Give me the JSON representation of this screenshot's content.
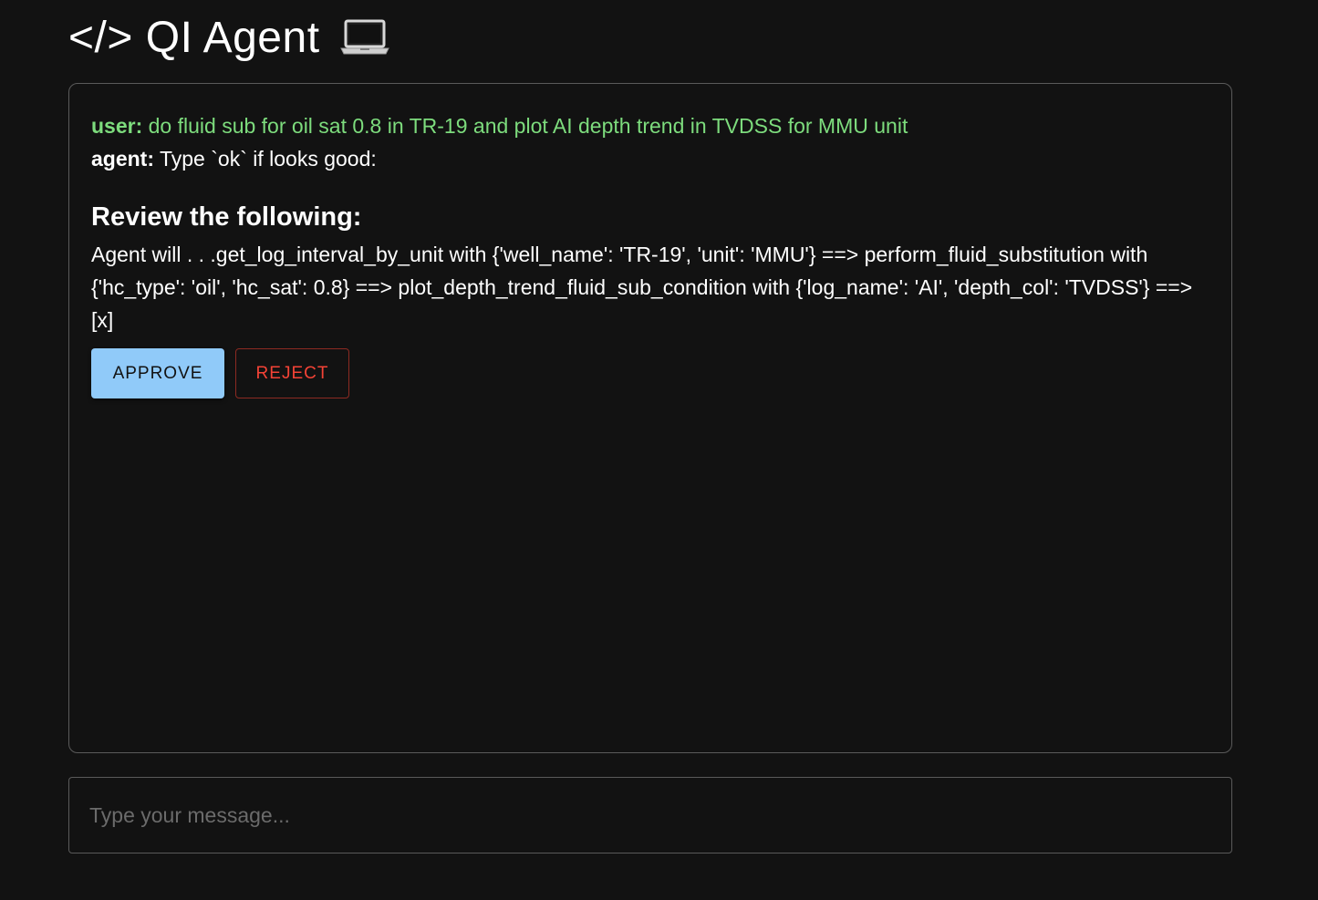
{
  "header": {
    "title": "</> QI Agent",
    "title_icon": "laptop-icon"
  },
  "chat": {
    "messages": [
      {
        "role": "user:",
        "text": "do fluid sub for oil sat 0.8 in TR-19 and plot AI depth trend in TVDSS for MMU unit"
      },
      {
        "role": "agent:",
        "text": "Type `ok` if looks good:"
      }
    ],
    "review": {
      "heading": "Review the following:",
      "body": "Agent will . . .get_log_interval_by_unit with {'well_name': 'TR-19', 'unit': 'MMU'} ==> perform_fluid_substitution with {'hc_type': 'oil', 'hc_sat': 0.8} ==> plot_depth_trend_fluid_sub_condition with {'log_name': 'AI', 'depth_col': 'TVDSS'} ==> [x]",
      "approve_label": "APPROVE",
      "reject_label": "REJECT"
    }
  },
  "composer": {
    "value": "",
    "placeholder": "Type your message..."
  },
  "colors": {
    "background": "#121212",
    "user_text": "#7ddc7d",
    "approve_bg": "#90caf9",
    "reject_text": "#f44336",
    "border": "#5a5a5a"
  }
}
